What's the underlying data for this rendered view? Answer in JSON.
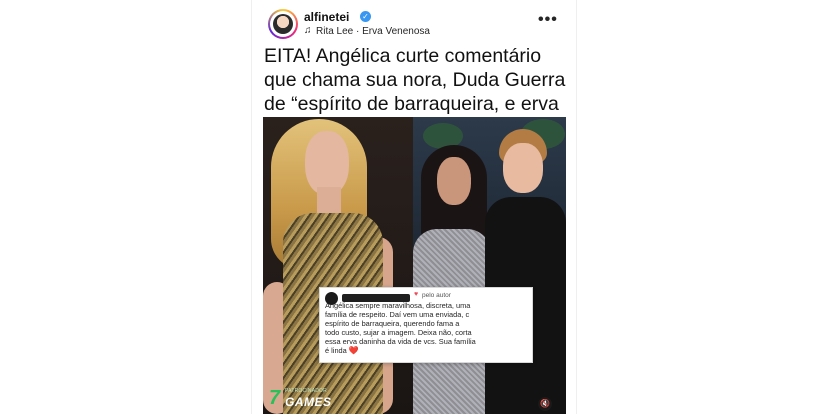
{
  "post": {
    "username": "alfinetei",
    "song": "Rita Lee · Erva Venenosa",
    "headline": "EITA! Angélica curte comentário que chama sua nora, Duda Guerra de “espírito de barraqueira, e erva daninha”",
    "verified_glyph": "✓",
    "music_glyph": "♫",
    "more_glyph": "•••"
  },
  "comment": {
    "liked_label": "pelo autor",
    "text": "Angélica sempre maravilhosa, discreta, uma\nfamília de respeito. Daí vem uma enviada, c\nespírito de barraqueira, querendo fama a\ntodo custo, sujar a imagem. Deixa não, corta\nessa erva daninha da vida de vcs. Sua família\né linda",
    "heart_emoji": "❤️"
  },
  "watermark": {
    "number": "7",
    "small_text": "PATROCINADOR",
    "brand": "GAMES"
  },
  "icons": {
    "mute": "🔇",
    "heart": "♥"
  },
  "colors": {
    "verified": "#3897f0",
    "heart": "#ed4956",
    "watermark_green": "#29c05a"
  }
}
